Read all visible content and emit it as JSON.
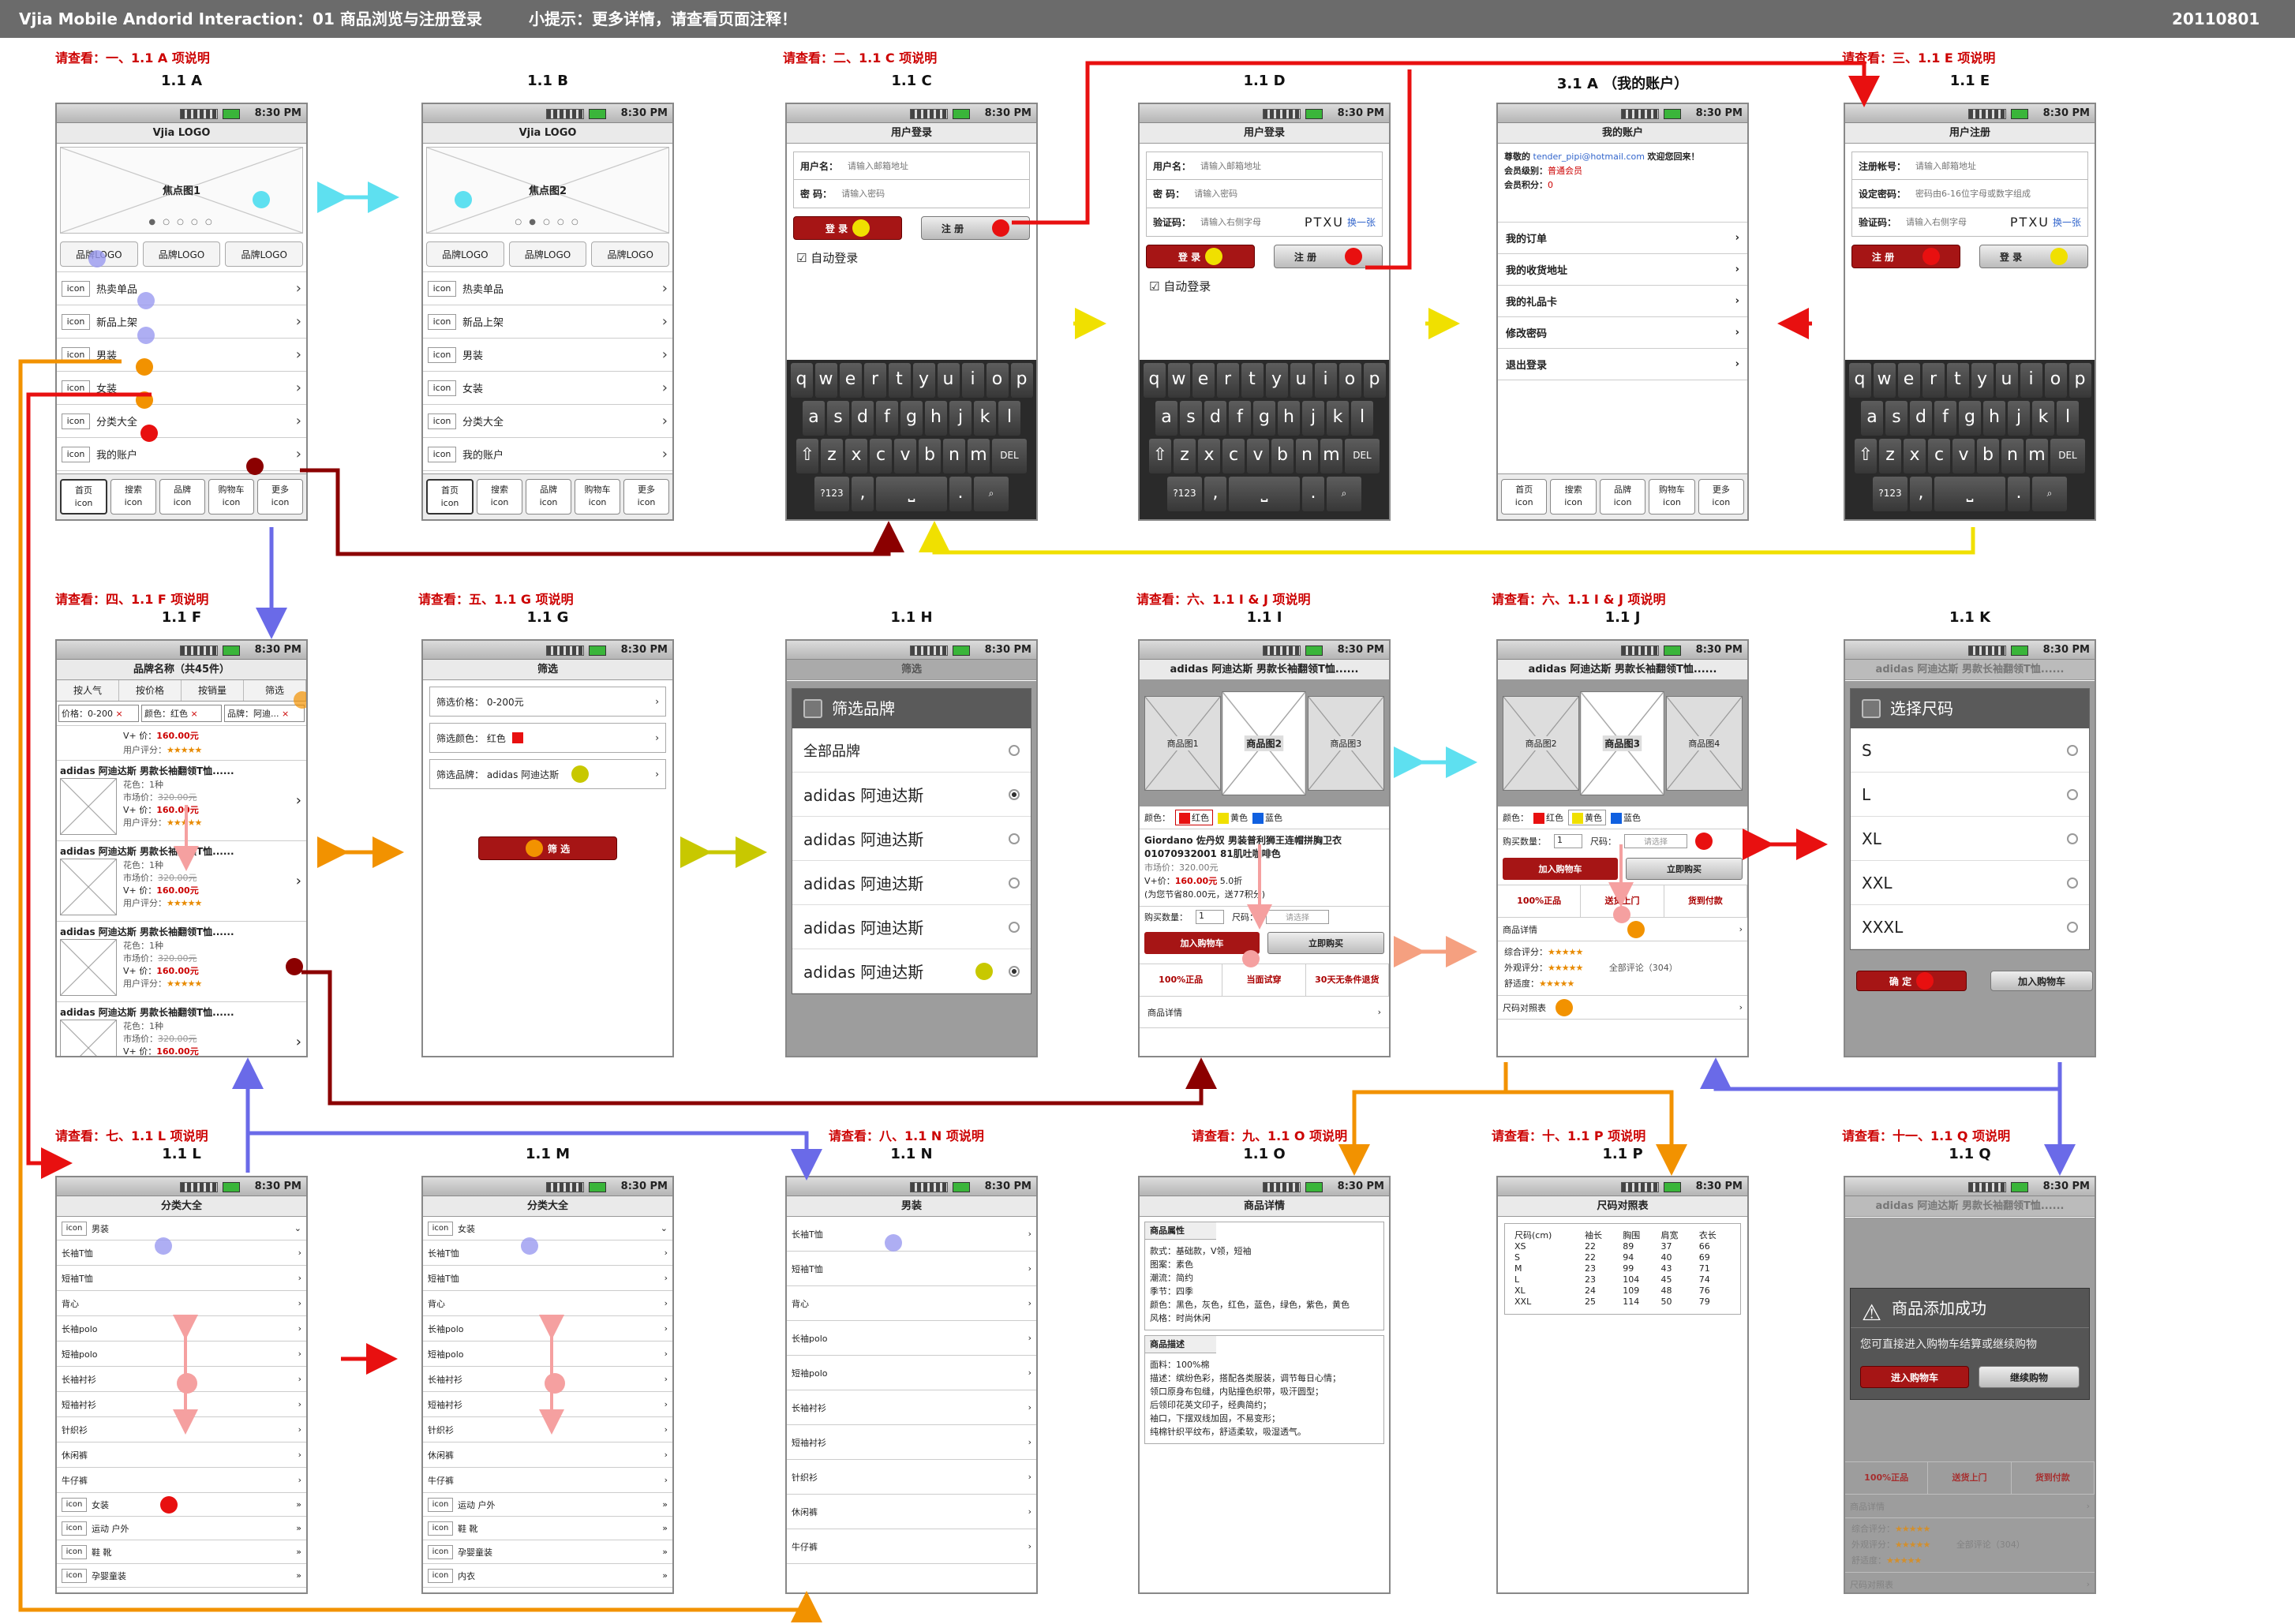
{
  "header": {
    "title": "Vjia  Mobile Andorid Interaction：01  商品浏览与注册登录",
    "tip": "小提示：更多详情，请查看页面注释！",
    "date": "20110801"
  },
  "status": {
    "time": "8:30 PM"
  },
  "notes": {
    "a": "请查看：一、1.1 A 项说明",
    "c": "请查看：二、1.1 C 项说明",
    "e": "请查看：三、1.1 E 项说明",
    "f": "请查看：四、1.1 F 项说明",
    "g": "请查看：五、1.1 G 项说明",
    "i": "请查看：六、1.1 I & J 项说明",
    "j": "请查看：六、1.1 I & J 项说明",
    "l": "请查看：七、1.1 L 项说明",
    "n": "请查看：八、1.1 N 项说明",
    "o": "请查看：九、1.1 O 项说明",
    "p": "请查看：十、1.1 P 项说明",
    "q": "请查看：十一、1.1 Q 项说明"
  },
  "labels": {
    "a": "1.1 A",
    "b": "1.1 B",
    "c": "1.1 C",
    "d": "1.1 D",
    "acc": "3.1 A （我的账户）",
    "e": "1.1 E",
    "f": "1.1 F",
    "g": "1.1 G",
    "h": "1.1 H",
    "i": "1.1 I",
    "j": "1.1 J",
    "k": "1.1 K",
    "l": "1.1 L",
    "m": "1.1 M",
    "n": "1.1 N",
    "o": "1.1 O",
    "p": "1.1 P",
    "q": "1.1 Q"
  },
  "home": {
    "logo": "Vjia  LOGO",
    "banner1": "焦点图1",
    "banner2": "焦点图2",
    "dots": "● ○ ○ ○ ○",
    "dots2": "○ ● ○ ○ ○",
    "brand": "品牌LOGO",
    "icon": "icon",
    "items": [
      "热卖单品",
      "新品上架",
      "男装",
      "女装",
      "分类大全",
      "我的账户"
    ]
  },
  "tabs": [
    "首页 icon",
    "搜索 icon",
    "品牌 icon",
    "购物车 icon",
    "更多 icon"
  ],
  "tabbar": [
    {
      "t": "首页",
      "i": "icon"
    },
    {
      "t": "搜索",
      "i": "icon"
    },
    {
      "t": "品牌",
      "i": "icon"
    },
    {
      "t": "购物车",
      "i": "icon"
    },
    {
      "t": "更多",
      "i": "icon"
    }
  ],
  "login": {
    "title": "用户登录",
    "user": "用户名：",
    "user_ph": "请输入邮箱地址",
    "pwd": "密    码：",
    "pwd_ph": "请输入密码",
    "code": "验证码：",
    "code_ph": "请输入右侧字母",
    "captcha": "PTXU",
    "change": "换一张",
    "login": "登 录",
    "reg": "注 册",
    "auto": "自动登录"
  },
  "register": {
    "title": "用户注册",
    "acc": "注册帐号：",
    "acc_ph": "请输入邮箱地址",
    "pwd": "设定密码：",
    "pwd_ph": "密码由6-16位字母或数字组成",
    "code": "验证码：",
    "code_ph": "请输入右侧字母",
    "reg": "注 册",
    "login": "登 录"
  },
  "keyboard": {
    "r1": [
      "q",
      "w",
      "e",
      "r",
      "t",
      "y",
      "u",
      "i",
      "o",
      "p"
    ],
    "r2": [
      "a",
      "s",
      "d",
      "f",
      "g",
      "h",
      "j",
      "k",
      "l"
    ],
    "r3": [
      "z",
      "x",
      "c",
      "v",
      "b",
      "n",
      "m"
    ],
    "shift": "⇧",
    "del": "DEL",
    "num": "?123",
    "comma": ",",
    "space": "⎵",
    "period": ".",
    "search": "⌕"
  },
  "account": {
    "title": "我的账户",
    "welcome1": "尊敬的",
    "email": "tender_pipi@hotmail.com",
    "welcome2": "欢迎您回来！",
    "level_l": "会员级别：",
    "level": "普通会员",
    "points_l": "会员积分：",
    "points": "0",
    "items": [
      "我的订单",
      "我的收货地址",
      "我的礼品卡",
      "修改密码",
      "退出登录"
    ]
  },
  "plist": {
    "title": "品牌名称（共45件）",
    "tabs": [
      "按人气",
      "按价格",
      "按销量",
      "筛选"
    ],
    "f1": "价格：0-200",
    "f2": "颜色：红色",
    "f3": "品牌：阿迪...",
    "name": "adidas 阿迪达斯  男款长袖翻领T恤......",
    "color": "花色：1种",
    "market": "市场价：",
    "mprice": "320.00元",
    "vip": "V+ 价：",
    "vprice": "160.00元",
    "rating": "用户评分：",
    "stars": "★★★★★",
    "x": "×"
  },
  "filter": {
    "title": "筛选",
    "price": "筛选价格：  0-200元",
    "color": "筛选颜色：  红色",
    "brand": "筛选品牌：  adidas 阿迪达斯",
    "btn": "筛 选"
  },
  "brandpick": {
    "title": "筛选",
    "dlg": "筛选品牌",
    "items": [
      "全部品牌",
      "adidas 阿迪达斯",
      "adidas 阿迪达斯",
      "adidas 阿迪达斯",
      "adidas 阿迪达斯",
      "adidas 阿迪达斯"
    ]
  },
  "detail": {
    "title": "adidas 阿迪达斯  男款长袖翻领T恤......",
    "imgs": [
      "商品图1",
      "商品图2",
      "商品图3"
    ],
    "imgs2": [
      "商品图2",
      "商品图3",
      "商品图4"
    ],
    "color_l": "颜色：",
    "colors": [
      "红色",
      "黄色",
      "蓝色"
    ],
    "desc": "Giordano 佐丹奴  男装普利狮王连帽拼胸卫衣 01070932001 81肌吐咖啡色",
    "market": "市场价：320.00元",
    "vip": "V+价：",
    "vprice": "160.00元",
    "disc": "5.0折",
    "save": "(为您节省80.00元，送77积分)",
    "qty": "购买数量：",
    "qtyv": "1",
    "size": "尺码：",
    "size_ph": "请选择",
    "cart": "加入购物车",
    "buy": "立即购买",
    "serv": [
      "100%正品",
      "当面试穿",
      "30天无条件退货"
    ],
    "info": "商品详情",
    "comp": "综合评分：",
    "look": "外观评分：",
    "comfort": "舒适度：",
    "comments": "全部评论（304）",
    "sizechart": "尺码对照表",
    "stars": "★★★★★",
    "serv2": [
      "100%正品",
      "送货上门",
      "货到付款"
    ]
  },
  "sizes": {
    "dlg": "选择尺码",
    "items": [
      "S",
      "L",
      "XL",
      "XXL",
      "XXXL"
    ],
    "ok": "确 定",
    "cart": "加入购物车"
  },
  "cats": {
    "title": "分类大全",
    "men": "男装",
    "women": "女装",
    "sport": "运动 户外",
    "shoes": "鞋 靴",
    "kids": "孕婴童装",
    "inner": "内衣",
    "sub": [
      "长袖T恤",
      "短袖T恤",
      "背心",
      "长袖polo",
      "短袖polo",
      "长袖衬衫",
      "短袖衬衫",
      "针织衫",
      "休闲裤",
      "牛仔裤"
    ]
  },
  "menlist": {
    "title": "男装",
    "items": [
      "长袖T恤",
      "短袖T恤",
      "背心",
      "长袖polo",
      "短袖polo",
      "长袖衬衫",
      "短袖衬衫",
      "针织衫",
      "休闲裤",
      "牛仔裤"
    ]
  },
  "info": {
    "title": "商品详情",
    "attr": "商品属性",
    "attrs": [
      "款式：基础款，V领，短袖",
      "图案：素色",
      "潮流：简约",
      "季节：四季",
      "颜色：黑色，灰色，红色，蓝色，绿色，紫色，黄色",
      "风格：时尚休闲"
    ],
    "descs_t": "商品描述",
    "descs": [
      "面料：100%棉",
      "描述：缤纷色彩，搭配各类服装，调节每日心情；",
      "领口原身布包缝，内贴撞色织带，吸汗圆型；",
      "后领印花英文印子，经典简约；",
      "袖口，下摆双线加固，不易变形；",
      "纯棉针织平纹布，舒适柔软，吸湿透气。"
    ]
  },
  "sizechart": {
    "title": "尺码对照表",
    "head": [
      "尺码(cm)",
      "袖长",
      "胸围",
      "肩宽",
      "衣长"
    ],
    "rows": [
      [
        "XS",
        "22",
        "89",
        "37",
        "66"
      ],
      [
        "S",
        "22",
        "94",
        "40",
        "69"
      ],
      [
        "M",
        "23",
        "99",
        "43",
        "71"
      ],
      [
        "L",
        "23",
        "104",
        "45",
        "74"
      ],
      [
        "XL",
        "24",
        "109",
        "48",
        "76"
      ],
      [
        "XXL",
        "25",
        "114",
        "50",
        "79"
      ]
    ]
  },
  "added": {
    "title": "商品添加成功",
    "msg": "您可直接进入购物车结算或继续购物",
    "go": "进入购物车",
    "cont": "继续购物"
  },
  "colors": {
    "cyan": "#5ee0f0",
    "red": "#e81010",
    "darkred": "#8b0000",
    "yellow": "#f0e000",
    "blue": "#6a6ae8",
    "orange": "#f29200",
    "olive": "#c8c800",
    "salmon": "#f5a080",
    "pink": "#f5a0a0"
  }
}
